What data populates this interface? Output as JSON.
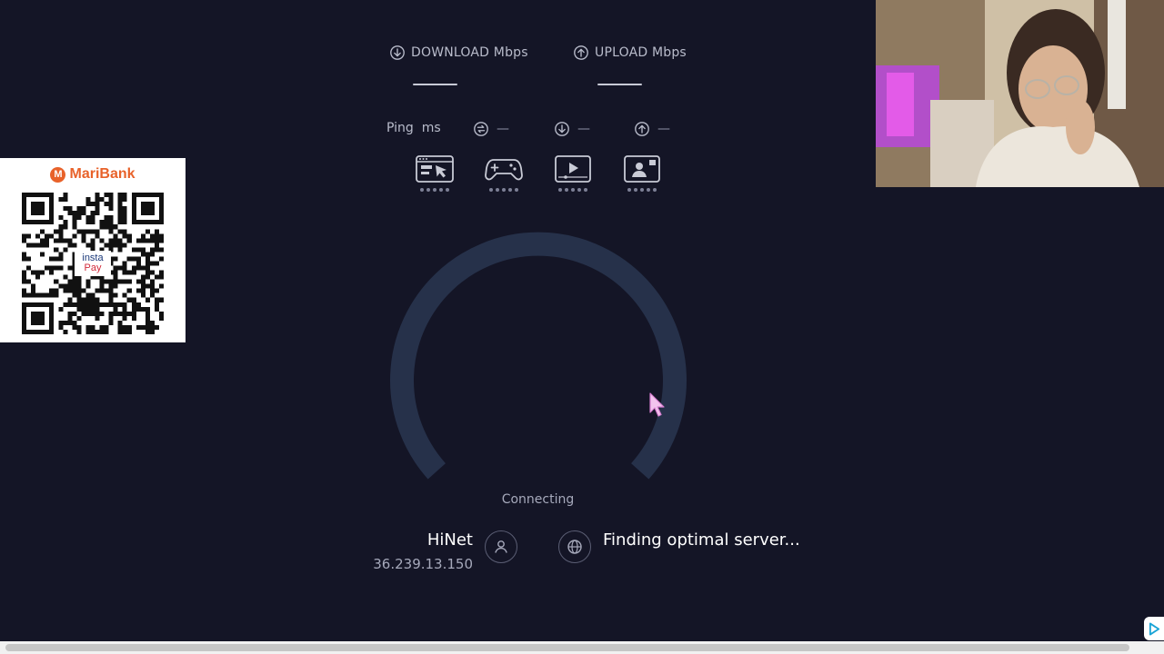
{
  "metrics": {
    "download_label": "DOWNLOAD Mbps",
    "upload_label": "UPLOAD Mbps"
  },
  "ping": {
    "label": "Ping",
    "unit": "ms",
    "idle_value": "—",
    "download_value": "—",
    "upload_value": "—"
  },
  "activities": [
    {
      "icon": "web-browsing-icon",
      "rating_dots": 5
    },
    {
      "icon": "gaming-controller-icon",
      "rating_dots": 5
    },
    {
      "icon": "video-streaming-icon",
      "rating_dots": 5
    },
    {
      "icon": "video-call-icon",
      "rating_dots": 5
    }
  ],
  "status": {
    "connecting": "Connecting"
  },
  "provider": {
    "name": "HiNet",
    "ip": "36.239.13.150"
  },
  "server": {
    "status": "Finding optimal server..."
  },
  "ad_overlay": {
    "brand": "MariBank",
    "badge_line1": "insta",
    "badge_line2": "Pay"
  },
  "colors": {
    "background": "#141526",
    "gauge_track": "#26314a",
    "text_primary": "#ffffff",
    "text_secondary": "#a6a9bb",
    "brand_orange": "#e8622a"
  }
}
